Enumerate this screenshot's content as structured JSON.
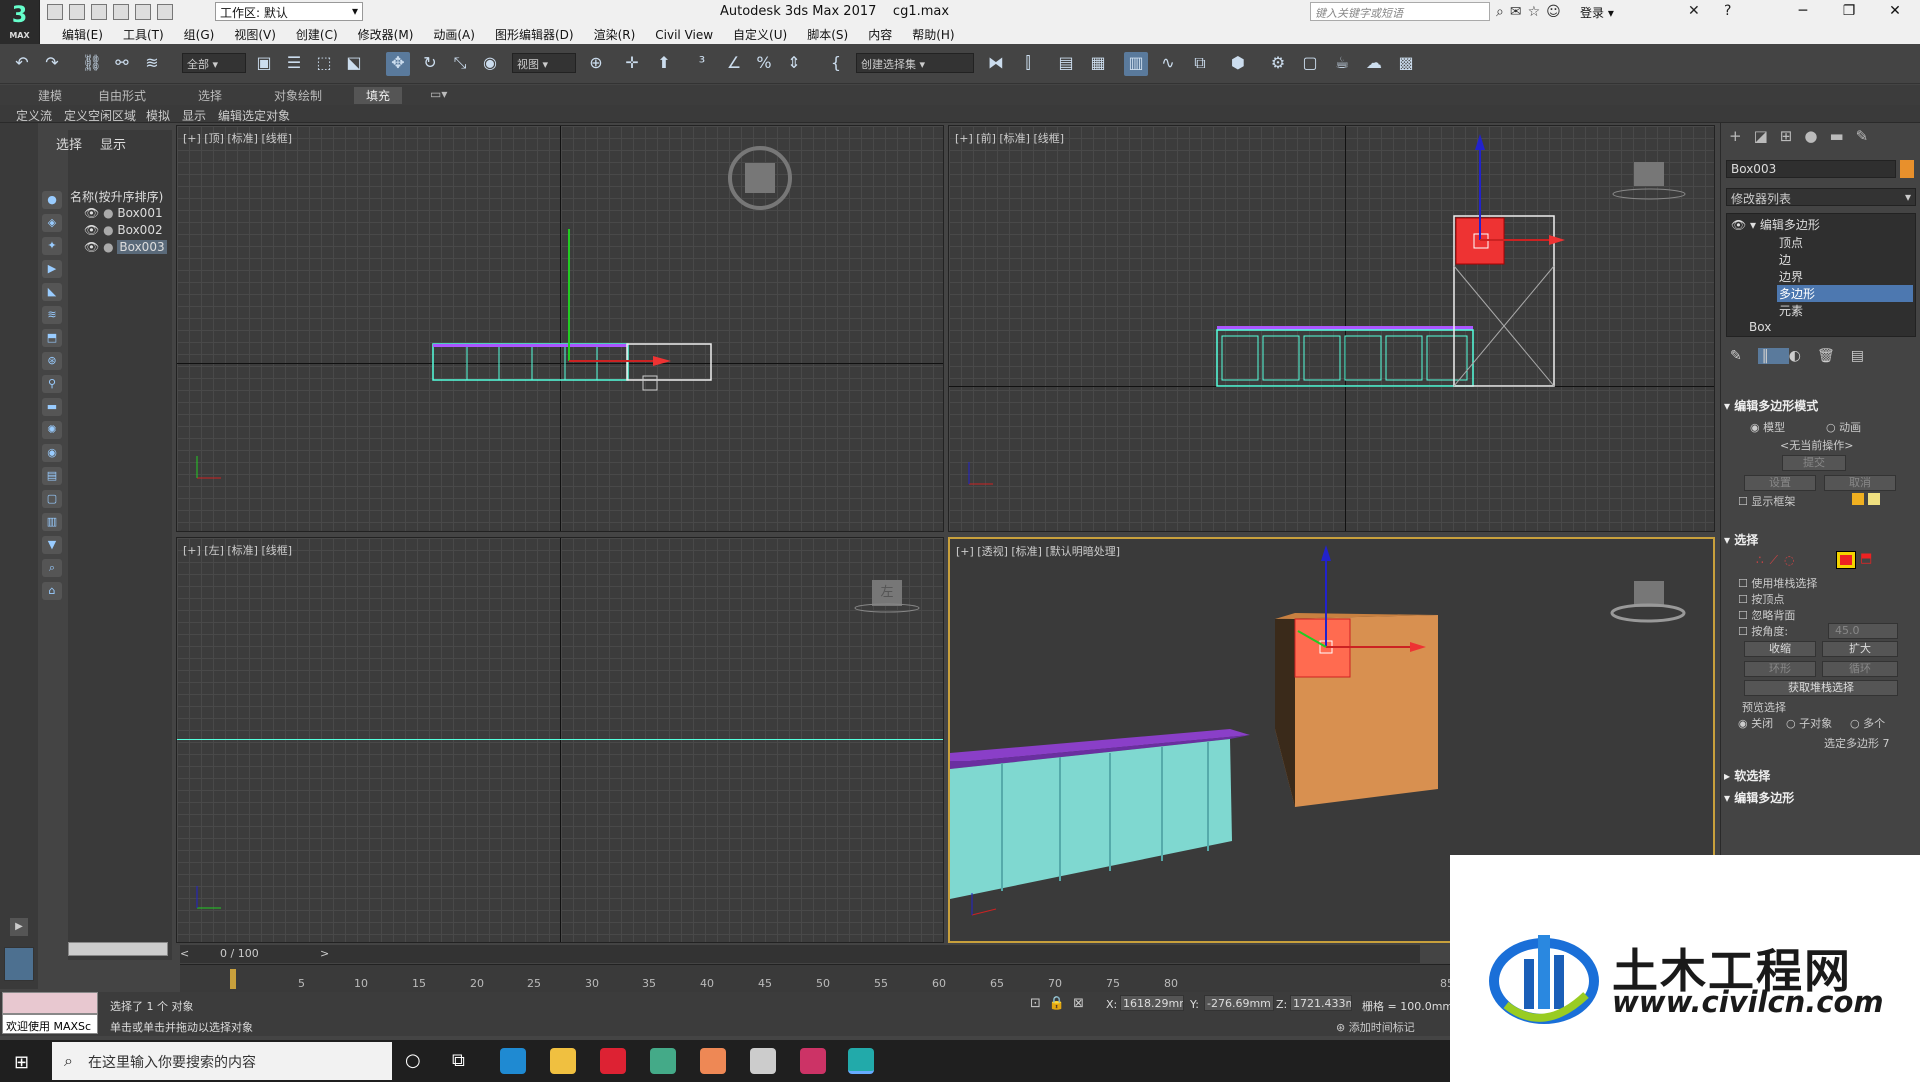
{
  "title_bar": {
    "workspace_label": "工作区: 默认",
    "app_title": "Autodesk 3ds Max 2017",
    "file_name": "cg1.max",
    "search_placeholder": "键入关键字或短语",
    "login_label": "登录"
  },
  "logo": {
    "mark": "3",
    "sub": "MAX"
  },
  "menu": [
    "编辑(E)",
    "工具(T)",
    "组(G)",
    "视图(V)",
    "创建(C)",
    "修改器(M)",
    "动画(A)",
    "图形编辑器(D)",
    "渲染(R)",
    "Civil View",
    "自定义(U)",
    "脚本(S)",
    "内容",
    "帮助(H)"
  ],
  "toolbar": {
    "filter_dropdown": "全部",
    "refcoord_dropdown": "视图",
    "selection_set_dropdown": "创建选择集"
  },
  "ribbon_tabs": [
    "建模",
    "自由形式",
    "选择",
    "对象绘制",
    "填充"
  ],
  "ribbon_active": "填充",
  "ribbon_tools": [
    "定义流",
    "定义空闲区域",
    "模拟",
    "显示",
    "编辑选定对象"
  ],
  "scene_explorer": {
    "tab_select": "选择",
    "tab_display": "显示",
    "header": "名称(按升序排序)",
    "objects": [
      "Box001",
      "Box002",
      "Box003"
    ],
    "selected": "Box003"
  },
  "viewports": {
    "top_label": "[+] [顶] [标准] [线框]",
    "front_label": "[+] [前] [标准] [线框]",
    "left_label": "[+] [左] [标准] [线框]",
    "perspective_label": "[+] [透视] [标准] [默认明暗处理]",
    "viewcube_left_face": "左",
    "viewcube_front_face": "前"
  },
  "command_panel": {
    "object_name": "Box003",
    "object_color": "#e8902c",
    "modifier_list": "修改器列表",
    "stack": {
      "modifier": "编辑多边形",
      "sub_items": [
        "顶点",
        "边",
        "边界",
        "多边形",
        "元素"
      ],
      "selected_sub": "多边形",
      "base": "Box"
    },
    "mode_rollout": {
      "title": "编辑多边形模式",
      "model": "模型",
      "animate": "动画",
      "no_op": "<无当前操作>",
      "commit": "提交",
      "settings": "设置",
      "cancel": "取消",
      "show_cage": "显示框架"
    },
    "selection_rollout": {
      "title": "选择",
      "use_stack": "使用堆栈选择",
      "by_vertex": "按顶点",
      "ignore_backfacing": "忽略背面",
      "by_angle": "按角度:",
      "angle_value": "45.0",
      "shrink": "收缩",
      "grow": "扩大",
      "ring": "环形",
      "loop": "循环",
      "get_stack": "获取堆栈选择",
      "preview": "预览选择",
      "off": "关闭",
      "subobject": "子对象",
      "multi": "多个",
      "status": "选定多边形 7"
    },
    "soft_selection": "软选择",
    "edit_polygons": "编辑多边形"
  },
  "timeline": {
    "slider_label": "0 / 100",
    "ticks": [
      "5",
      "10",
      "15",
      "20",
      "25",
      "30",
      "35",
      "40",
      "45",
      "50",
      "55",
      "60",
      "65",
      "70",
      "75",
      "80",
      "85"
    ]
  },
  "status": {
    "maxscript_label": "欢迎使用 MAXSc",
    "selected_msg": "选择了 1 个 对象",
    "prompt_msg": "单击或单击并拖动以选择对象",
    "x_label": "X:",
    "x_value": "1618.29mm",
    "y_label": "Y:",
    "y_value": "-276.69mm",
    "z_label": "Z:",
    "z_value": "1721.433m",
    "grid": "栅格 = 100.0mm",
    "add_time_tag": "添加时间标记"
  },
  "taskbar": {
    "search_placeholder": "在这里输入你要搜索的内容"
  },
  "watermark": {
    "brand": "土木工程网",
    "url": "www.civilcn.com"
  }
}
